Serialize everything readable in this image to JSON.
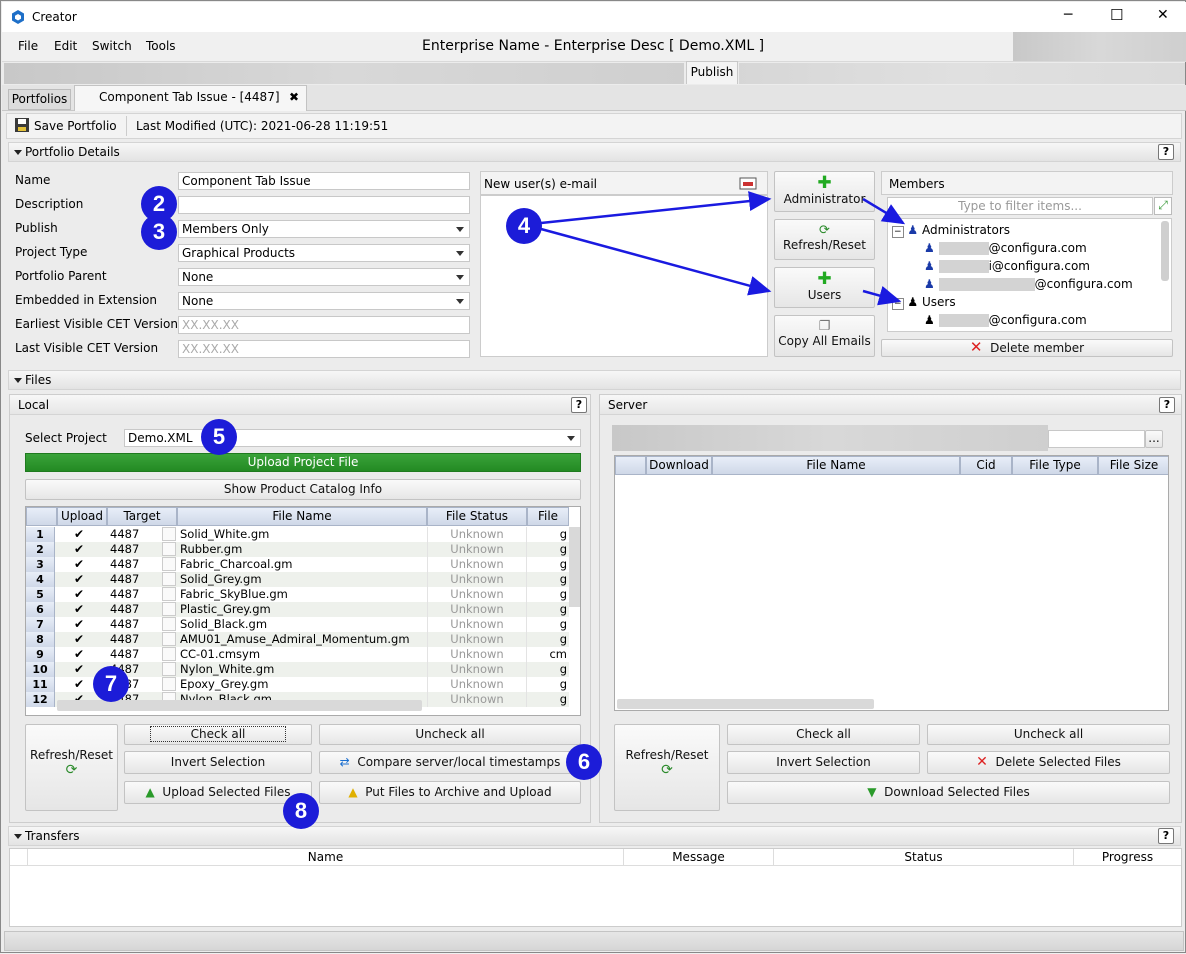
{
  "window": {
    "app_title": "Creator",
    "doc_title": "Enterprise Name - Enterprise Desc [ Demo.XML ]",
    "controls": {
      "minimize": "─",
      "maximize": "☐",
      "close": "✕"
    }
  },
  "menu": [
    "File",
    "Edit",
    "Switch",
    "Tools"
  ],
  "publish_tab": "Publish",
  "tabs": {
    "portfolios": "Portfolios",
    "component": "Component Tab Issue -  [4487]",
    "close": "✖"
  },
  "toolbar": {
    "save": "Save Portfolio",
    "modified": "Last Modified (UTC): 2021-06-28 11:19:51"
  },
  "details": {
    "header": "Portfolio Details",
    "fields": [
      {
        "label": "Name",
        "value": "Component Tab Issue",
        "type": "text"
      },
      {
        "label": "Description",
        "value": "",
        "type": "text"
      },
      {
        "label": "Publish",
        "value": "Members Only",
        "type": "select"
      },
      {
        "label": "Project Type",
        "value": "Graphical Products",
        "type": "select"
      },
      {
        "label": "Portfolio Parent",
        "value": "None",
        "type": "select"
      },
      {
        "label": "Embedded in Extension",
        "value": "None",
        "type": "select"
      },
      {
        "label": "Earliest Visible CET Version",
        "placeholder": "XX.XX.XX",
        "type": "text"
      },
      {
        "label": "Last Visible CET Version",
        "placeholder": "XX.XX.XX",
        "type": "text"
      }
    ],
    "new_users_label": "New user(s) e-mail",
    "btn_admin": "Administrator",
    "btn_refresh": "Refresh/Reset",
    "btn_users": "Users",
    "btn_copy": "Copy All Emails",
    "members_label": "Members",
    "filter_placeholder": "Type to filter items...",
    "admins_label": "Administrators",
    "admin_emails": [
      "@configura.com",
      "i@configura.com",
      "@configura.com"
    ],
    "users_label": "Users",
    "user_emails": [
      "@configura.com"
    ],
    "delete_member": "Delete member"
  },
  "files": {
    "header": "Files",
    "local": {
      "title": "Local",
      "select_project_label": "Select Project",
      "select_project_value": "Demo.XML",
      "upload_project": "Upload Project File",
      "show_catalog": "Show Product Catalog Info",
      "columns": [
        "Upload",
        "Target",
        "File Name",
        "File Status",
        "File"
      ],
      "rows": [
        {
          "n": "1",
          "target": "4487",
          "name": "Solid_White.gm",
          "status": "Unknown",
          "ext": "g"
        },
        {
          "n": "2",
          "target": "4487",
          "name": "Rubber.gm",
          "status": "Unknown",
          "ext": "g"
        },
        {
          "n": "3",
          "target": "4487",
          "name": "Fabric_Charcoal.gm",
          "status": "Unknown",
          "ext": "g"
        },
        {
          "n": "4",
          "target": "4487",
          "name": "Solid_Grey.gm",
          "status": "Unknown",
          "ext": "g"
        },
        {
          "n": "5",
          "target": "4487",
          "name": "Fabric_SkyBlue.gm",
          "status": "Unknown",
          "ext": "g"
        },
        {
          "n": "6",
          "target": "4487",
          "name": "Plastic_Grey.gm",
          "status": "Unknown",
          "ext": "g"
        },
        {
          "n": "7",
          "target": "4487",
          "name": "Solid_Black.gm",
          "status": "Unknown",
          "ext": "g"
        },
        {
          "n": "8",
          "target": "4487",
          "name": "AMU01_Amuse_Admiral_Momentum.gm",
          "status": "Unknown",
          "ext": "g"
        },
        {
          "n": "9",
          "target": "4487",
          "name": "CC-01.cmsym",
          "status": "Unknown",
          "ext": "cm"
        },
        {
          "n": "10",
          "target": "4487",
          "name": "Nylon_White.gm",
          "status": "Unknown",
          "ext": "g"
        },
        {
          "n": "11",
          "target": "4487",
          "name": "Epoxy_Grey.gm",
          "status": "Unknown",
          "ext": "g"
        },
        {
          "n": "12",
          "target": "4487",
          "name": "Nylon_Black.gm",
          "status": "Unknown",
          "ext": "g"
        }
      ],
      "refresh": "Refresh/Reset",
      "check_all": "Check all",
      "uncheck_all": "Uncheck all",
      "invert": "Invert Selection",
      "compare": "Compare server/local timestamps",
      "upload_selected": "Upload Selected Files",
      "archive": "Put Files to Archive and Upload"
    },
    "server": {
      "title": "Server",
      "browse": "...",
      "columns": [
        "Download",
        "File Name",
        "Cid",
        "File Type",
        "File Size"
      ],
      "refresh": "Refresh/Reset",
      "check_all": "Check all",
      "uncheck_all": "Uncheck all",
      "invert": "Invert Selection",
      "delete": "Delete Selected Files",
      "download": "Download Selected Files"
    }
  },
  "transfers": {
    "header": "Transfers",
    "columns": [
      "Name",
      "Message",
      "Status",
      "Progress"
    ]
  },
  "help": "?",
  "markers": [
    "2",
    "3",
    "4",
    "5",
    "6",
    "7",
    "8"
  ],
  "colors": {
    "marker": "#1c1cd8",
    "upload_green": "#2e9a2e",
    "arrow": "#1a1ae0",
    "plus_green": "#22aa22",
    "delete_red": "#dd2222"
  }
}
